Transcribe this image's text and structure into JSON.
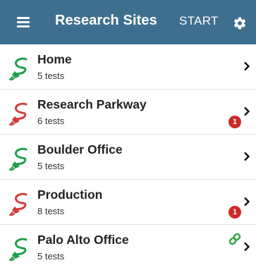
{
  "appbar": {
    "title": "Research Sites",
    "start_label": "START",
    "background": "#3f6f8e"
  },
  "sites": [
    {
      "name": "Home",
      "tests": "5 tests",
      "status": "green",
      "badge": null,
      "linked": false
    },
    {
      "name": "Research Parkway",
      "tests": "6 tests",
      "status": "red",
      "badge": "1",
      "linked": false
    },
    {
      "name": "Boulder Office",
      "tests": "5 tests",
      "status": "green",
      "badge": null,
      "linked": false
    },
    {
      "name": "Production",
      "tests": "8 tests",
      "status": "red",
      "badge": "1",
      "linked": false
    },
    {
      "name": "Palo Alto Office",
      "tests": "5 tests",
      "status": "green",
      "badge": null,
      "linked": true
    }
  ],
  "colors": {
    "ok": "#1f9e4a",
    "fail": "#d23c3c",
    "badge": "#cc2a2a",
    "link": "#3aa64a"
  },
  "icons": {
    "menu": "hamburger-menu-icon",
    "settings": "gear-icon",
    "site": "cable-plug-icon",
    "chevron": "chevron-right-icon",
    "link": "link-icon"
  }
}
